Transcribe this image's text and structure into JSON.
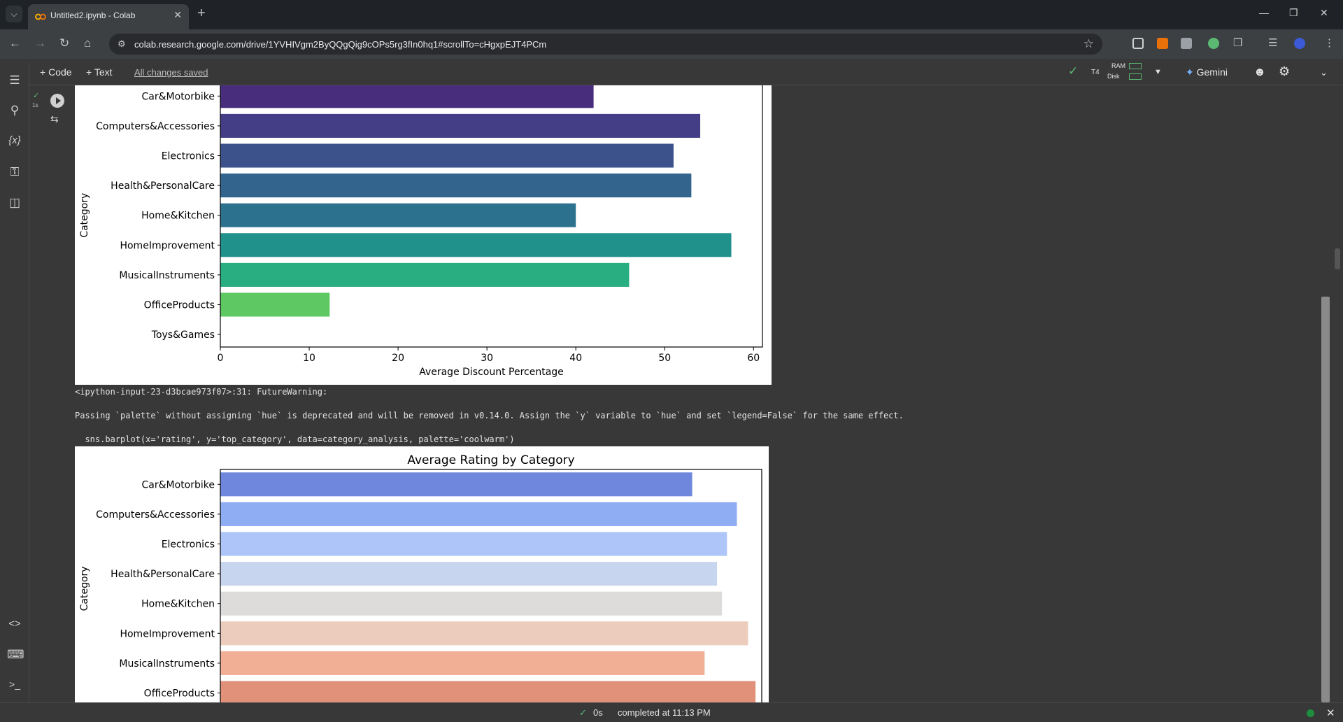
{
  "browser": {
    "tab_title": "Untitled2.ipynb - Colab",
    "url": "colab.research.google.com/drive/1YVHIVgm2ByQQgQig9cOPs5rg3fIn0hq1#scrollTo=cHgxpEJT4PCm"
  },
  "toolbar": {
    "code_label": "Code",
    "text_label": "Text",
    "saved_status": "All changes saved",
    "runtime_label": "T4",
    "ram_label": "RAM",
    "disk_label": "Disk",
    "gemini_label": "Gemini"
  },
  "cell": {
    "exec_time": "1s"
  },
  "warning": {
    "line1": "<ipython-input-23-d3bcae973f07>:31: FutureWarning:",
    "line2": "Passing `palette` without assigning `hue` is deprecated and will be removed in v0.14.0. Assign the `y` variable to `hue` and set `legend=False` for the same effect.",
    "line3": "  sns.barplot(x='rating', y='top_category', data=category_analysis, palette='coolwarm')"
  },
  "status": {
    "elapsed": "0s",
    "completed": "completed at 11:13 PM"
  },
  "chart_data": [
    {
      "type": "bar",
      "orientation": "horizontal",
      "title": "",
      "xlabel": "Average Discount Percentage",
      "ylabel": "Category",
      "xlim": [
        0,
        61
      ],
      "xticks": [
        0,
        10,
        20,
        30,
        40,
        50,
        60
      ],
      "categories": [
        "Car&Motorbike",
        "Computers&Accessories",
        "Electronics",
        "Health&PersonalCare",
        "Home&Kitchen",
        "HomeImprovement",
        "MusicalInstruments",
        "OfficeProducts",
        "Toys&Games"
      ],
      "values": [
        42,
        54,
        51,
        53,
        40,
        57.5,
        46,
        12.3,
        0
      ],
      "colors": [
        "#472d7b",
        "#433e85",
        "#3b528b",
        "#32648e",
        "#2c728e",
        "#21918c",
        "#28ae80",
        "#5ec962",
        "#a0da39"
      ]
    },
    {
      "type": "bar",
      "orientation": "horizontal",
      "title": "Average Rating by Category",
      "xlabel": "",
      "ylabel": "Category",
      "xlim": [
        0,
        4.36
      ],
      "categories": [
        "Car&Motorbike",
        "Computers&Accessories",
        "Electronics",
        "Health&PersonalCare",
        "Home&Kitchen",
        "HomeImprovement",
        "MusicalInstruments",
        "OfficeProducts"
      ],
      "values": [
        3.8,
        4.16,
        4.08,
        4.0,
        4.04,
        4.25,
        3.9,
        4.31
      ],
      "colors": [
        "#6f88dd",
        "#8fadf3",
        "#adc5f8",
        "#c8d5ee",
        "#dddcdb",
        "#ecccbc",
        "#f1b095",
        "#e1907a"
      ]
    }
  ]
}
